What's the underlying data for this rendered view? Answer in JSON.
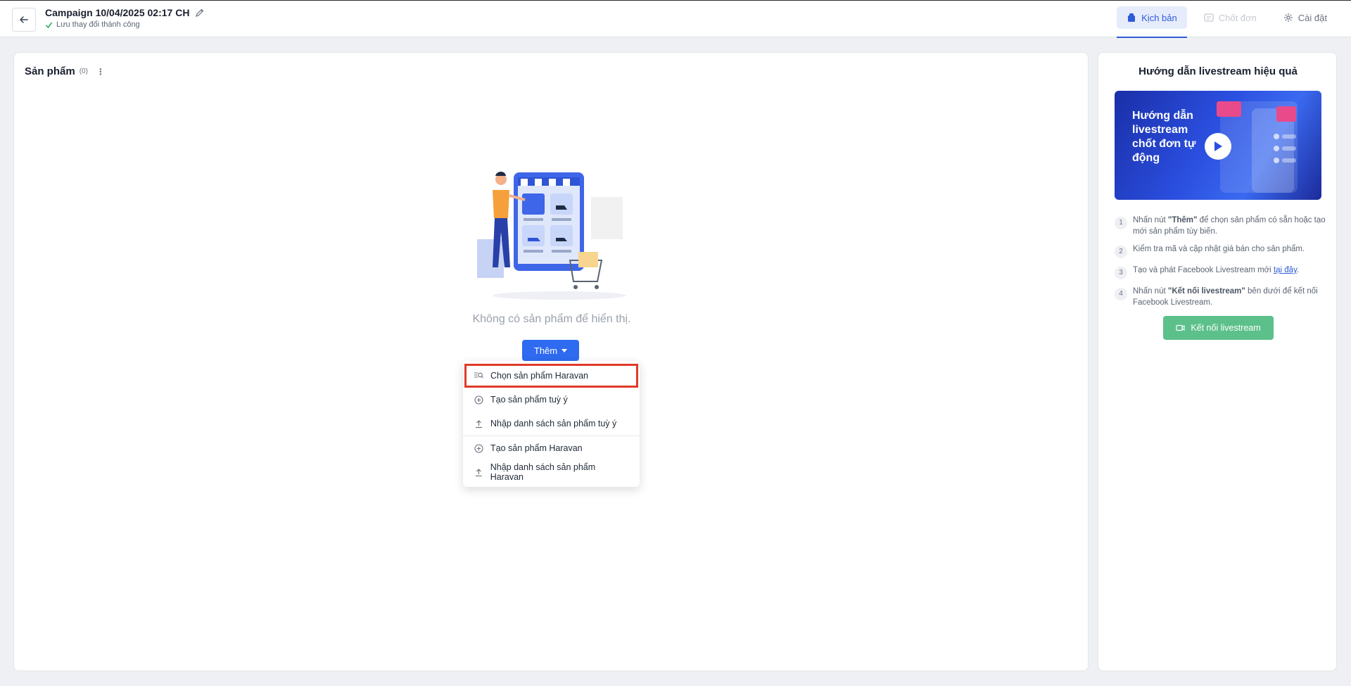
{
  "header": {
    "campaign_title": "Campaign 10/04/2025 02:17 CH",
    "save_status": "Lưu thay đổi thành công",
    "tabs": [
      {
        "label": "Kịch bản",
        "icon": "script-icon",
        "state": "active"
      },
      {
        "label": "Chốt đơn",
        "icon": "order-icon",
        "state": "disabled"
      },
      {
        "label": "Cài đặt",
        "icon": "gear-icon",
        "state": "normal"
      }
    ]
  },
  "products": {
    "title": "Sản phẩm",
    "count": "(0)",
    "empty_message": "Không có sản phẩm để hiển thị.",
    "add_button": "Thêm",
    "dropdown": [
      {
        "label": "Chọn sản phẩm Haravan",
        "icon": "search-list-icon"
      },
      {
        "label": "Tạo sản phẩm tuỳ ý",
        "icon": "plus-circle-icon"
      },
      {
        "label": "Nhập danh sách sản phẩm tuỳ ý",
        "icon": "upload-icon"
      },
      {
        "label": "Tạo sản phẩm Haravan",
        "icon": "plus-circle-icon"
      },
      {
        "label": "Nhập danh sách sản phẩm Haravan",
        "icon": "upload-icon"
      }
    ]
  },
  "guide": {
    "title": "Hướng dẫn livestream hiệu quả",
    "video_text": "Hướng dẫn livestream chốt đơn tự động",
    "steps": [
      {
        "num": "1",
        "pre": "Nhấn nút ",
        "bold": "\"Thêm\"",
        "post": " để chọn sản phẩm có sẵn hoặc tạo mới sản phẩm tùy biến."
      },
      {
        "num": "2",
        "pre": "Kiểm tra mã và cập nhật giá bán cho sản phẩm.",
        "bold": "",
        "post": ""
      },
      {
        "num": "3",
        "pre": "Tạo và phát Facebook Livestream mới ",
        "link": "tại đây",
        "post": "."
      },
      {
        "num": "4",
        "pre": "Nhấn nút ",
        "bold": "\"Kết nối livestream\"",
        "post": " bên dưới để kết nối Facebook Livestream."
      }
    ],
    "connect_button": "Kết nối livestream"
  },
  "colors": {
    "primary": "#2f6bf0",
    "success": "#5cc08a",
    "highlight": "#e03a2b"
  }
}
